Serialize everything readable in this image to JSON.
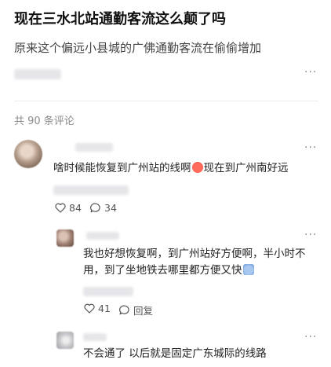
{
  "post": {
    "title": "现在三水北站通勤客流这么颠了吗",
    "subtitle": "原来这个偏远小县城的广佛通勤客流在偷偷增加"
  },
  "comments_header": {
    "count_text": "共 90 条评论"
  },
  "more_glyph": "···",
  "comments": [
    {
      "text": "啥时候能恢复到广州站的线啊",
      "text_after": "现在到广州南好远",
      "emoji": "angry-face",
      "likes": "84",
      "replies": "34"
    }
  ],
  "replies": [
    {
      "text_line1": "我也好想恢复啊，到广州站好方便啊，半小时不",
      "text_line2": "用，到了坐地铁去哪里都方便又快",
      "emoji": "sweat-face",
      "likes": "41",
      "reply_label": "回复"
    },
    {
      "text": "不会通了 以后就是固定广东城际的线路"
    }
  ],
  "colors": {
    "background": "#ffffff",
    "meta_gray": "#8a8a8a",
    "blur_gray": "#e6e6ea"
  }
}
